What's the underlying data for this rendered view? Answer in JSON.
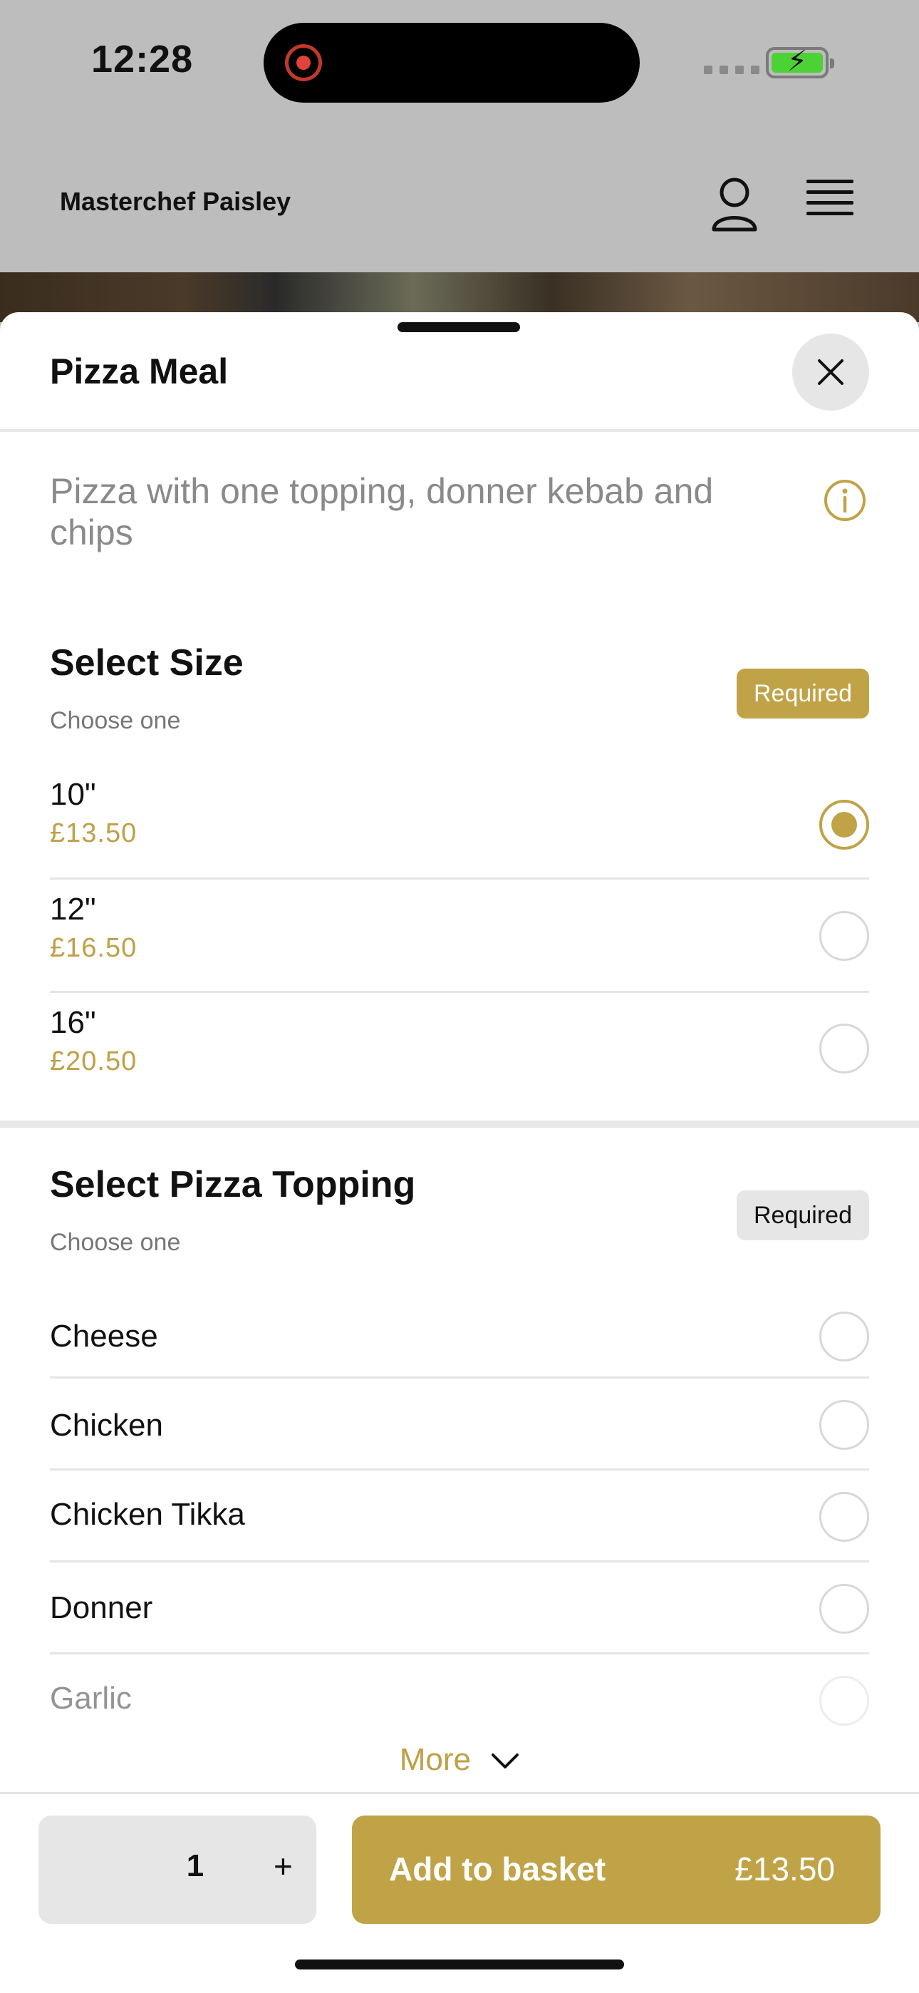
{
  "status_bar": {
    "time": "12:28"
  },
  "header": {
    "brand": "Masterchef Paisley",
    "account_icon": "person-icon",
    "menu_icon": "hamburger-icon"
  },
  "sheet": {
    "title": "Pizza Meal",
    "description": "Pizza with one topping, donner kebab and chips",
    "info_icon": "info-icon"
  },
  "size_section": {
    "title": "Select Size",
    "subtitle": "Choose one",
    "badge": "Required",
    "options": [
      {
        "name": "10\"",
        "price": "£13.50",
        "selected": true
      },
      {
        "name": "12\"",
        "price": "£16.50",
        "selected": false
      },
      {
        "name": "16\"",
        "price": "£20.50",
        "selected": false
      }
    ]
  },
  "topping_section": {
    "title": "Select Pizza Topping",
    "subtitle": "Choose one",
    "badge": "Required",
    "options": [
      {
        "name": "Cheese",
        "selected": false
      },
      {
        "name": "Chicken",
        "selected": false
      },
      {
        "name": "Chicken Tikka",
        "selected": false
      },
      {
        "name": "Donner",
        "selected": false
      },
      {
        "name": "Garlic",
        "selected": false
      }
    ],
    "more_label": "More"
  },
  "footer": {
    "quantity": "1",
    "plus_label": "+",
    "add_label": "Add to basket",
    "add_price": "£13.50"
  },
  "colors": {
    "accent": "#c0a346",
    "price": "#bfa047",
    "badge_grey": "#e6e6e6"
  }
}
